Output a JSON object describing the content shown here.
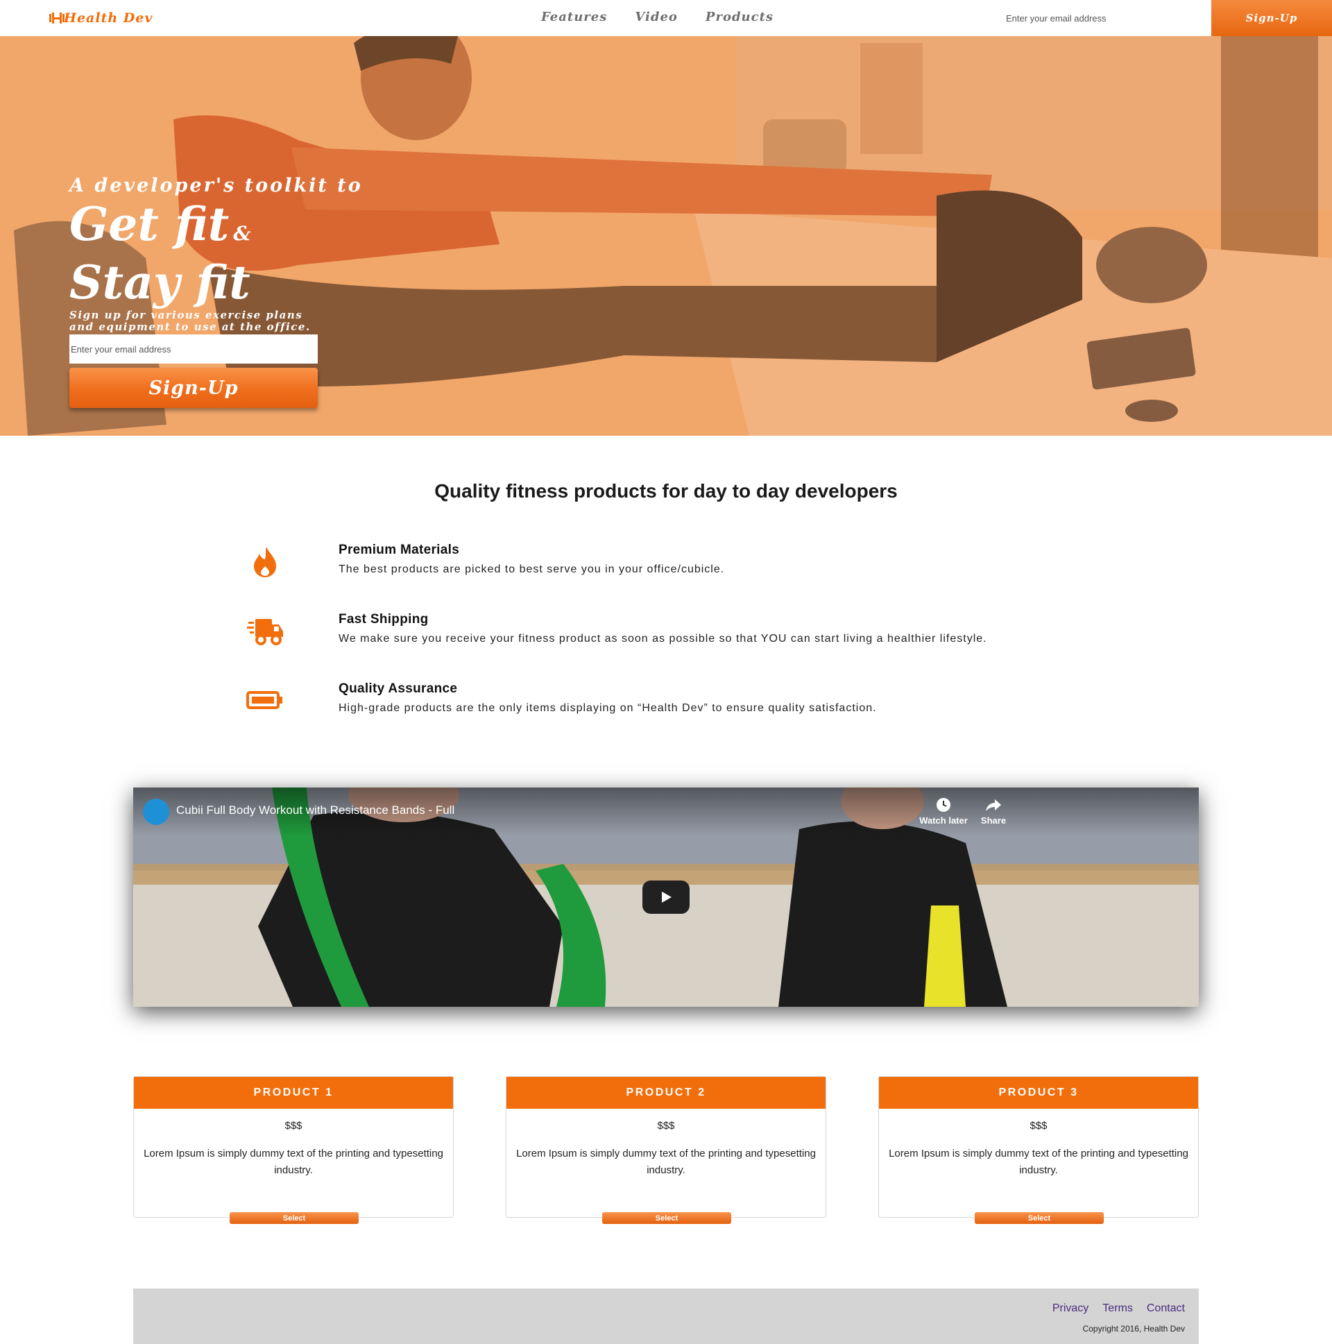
{
  "nav": {
    "logo_text": "Health Dev",
    "links": [
      "Features",
      "Video",
      "Products"
    ],
    "email_placeholder": "Enter your email address",
    "signup_label": "Sign-Up"
  },
  "hero": {
    "kicker": "A developer's toolkit to",
    "headline_line1": "Get fit",
    "headline_amp": "&",
    "headline_line2": "Stay fit",
    "subtext": "Sign up for various exercise plans and equipment to use at the office.",
    "email_placeholder": "Enter your email address",
    "signup_label": "Sign-Up"
  },
  "features": {
    "title": "Quality fitness products for day to day developers",
    "items": [
      {
        "icon": "flame-icon",
        "title": "Premium Materials",
        "description": "The best products are picked to best serve you in your office/cubicle."
      },
      {
        "icon": "truck-icon",
        "title": "Fast Shipping",
        "description": "We make sure you receive your fitness product as soon as possible so that YOU can start living a healthier lifestyle."
      },
      {
        "icon": "battery-icon",
        "title": "Quality Assurance",
        "description": "High-grade products are the only items displaying on “Health Dev” to ensure quality satisfaction."
      }
    ]
  },
  "video": {
    "title": "Cubii Full Body Workout with Resistance Bands - Full",
    "watch_later_label": "Watch later",
    "share_label": "Share"
  },
  "products": [
    {
      "name": "PRODUCT 1",
      "price": "$$$",
      "description": "Lorem Ipsum is simply dummy text of the printing and typesetting industry.",
      "button": "Select"
    },
    {
      "name": "PRODUCT 2",
      "price": "$$$",
      "description": "Lorem Ipsum is simply dummy text of the printing and typesetting industry.",
      "button": "Select"
    },
    {
      "name": "PRODUCT 3",
      "price": "$$$",
      "description": "Lorem Ipsum is simply dummy text of the printing and typesetting industry.",
      "button": "Select"
    }
  ],
  "footer": {
    "links": [
      "Privacy",
      "Terms",
      "Contact"
    ],
    "copyright": "Copyright 2016, Health Dev"
  },
  "colors": {
    "accent": "#f26e0c",
    "footer_bg": "#d4d4d4",
    "footer_link": "#4b2c7e"
  }
}
